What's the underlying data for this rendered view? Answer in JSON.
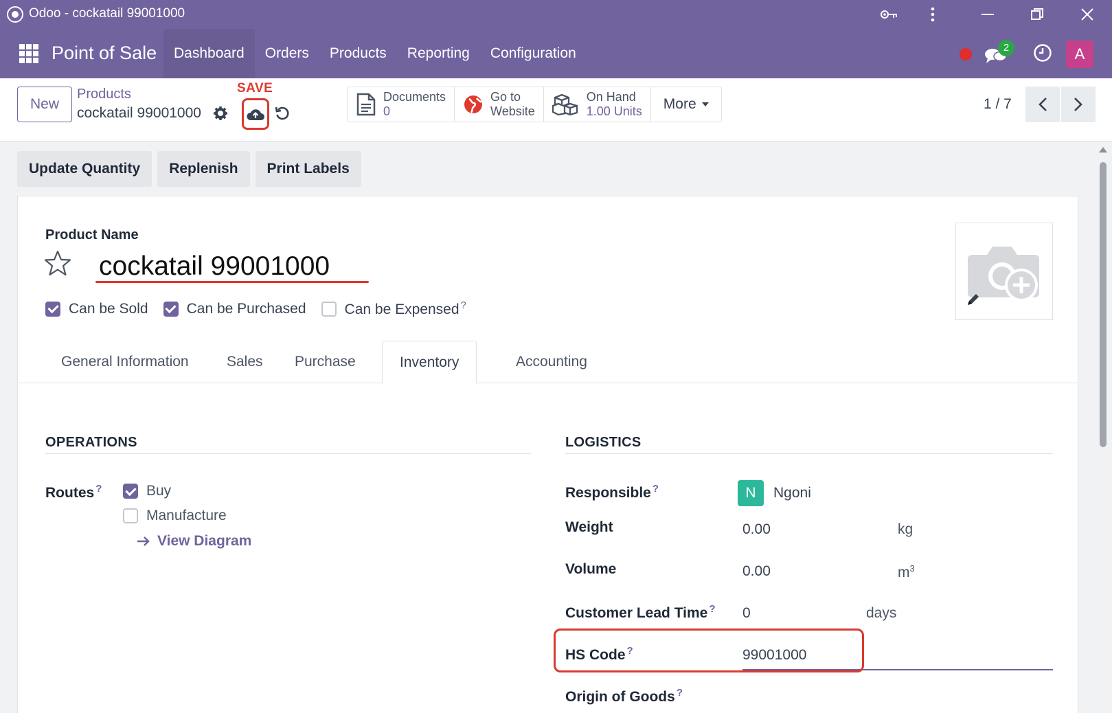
{
  "window": {
    "title": "Odoo - cockatail 99001000"
  },
  "navbar": {
    "brand": "Point of Sale",
    "menu": [
      "Dashboard",
      "Orders",
      "Products",
      "Reporting",
      "Configuration"
    ],
    "chat_count": "2",
    "avatar_letter": "A"
  },
  "control_panel": {
    "new_label": "New",
    "breadcrumb_parent": "Products",
    "breadcrumb_current": "cockatail 99001000",
    "save_annotation": "SAVE",
    "smart_buttons": {
      "documents_label": "Documents",
      "documents_value": "0",
      "website_line1": "Go to",
      "website_line2": "Website",
      "onhand_label": "On Hand",
      "onhand_value": "1.00 Units",
      "more_label": "More"
    },
    "pager": "1 / 7"
  },
  "actions": [
    "Update Quantity",
    "Replenish",
    "Print Labels"
  ],
  "product": {
    "name_label": "Product Name",
    "name": "cockatail 99001000",
    "flags": [
      {
        "label": "Can be Sold",
        "checked": true
      },
      {
        "label": "Can be Purchased",
        "checked": true
      },
      {
        "label": "Can be Expensed",
        "checked": false,
        "help": "?"
      }
    ]
  },
  "tabs": [
    "General Information",
    "Sales",
    "Purchase",
    "Inventory",
    "Accounting"
  ],
  "operations": {
    "title": "OPERATIONS",
    "routes_label": "Routes",
    "routes": [
      {
        "label": "Buy",
        "checked": true
      },
      {
        "label": "Manufacture",
        "checked": false
      }
    ],
    "view_diagram": "View Diagram"
  },
  "logistics": {
    "title": "LOGISTICS",
    "responsible_label": "Responsible",
    "responsible_initial": "N",
    "responsible_name": "Ngoni",
    "weight_label": "Weight",
    "weight_value": "0.00",
    "weight_unit": "kg",
    "volume_label": "Volume",
    "volume_value": "0.00",
    "volume_unit": "m",
    "volume_unit_sup": "3",
    "lead_time_label": "Customer Lead Time",
    "lead_time_value": "0",
    "lead_time_unit": "days",
    "hs_code_label": "HS Code",
    "hs_code_value": "99001000",
    "origin_label": "Origin of Goods"
  },
  "colors": {
    "brand": "#71639e",
    "annotation": "#d93a2f",
    "success": "#28a745"
  }
}
